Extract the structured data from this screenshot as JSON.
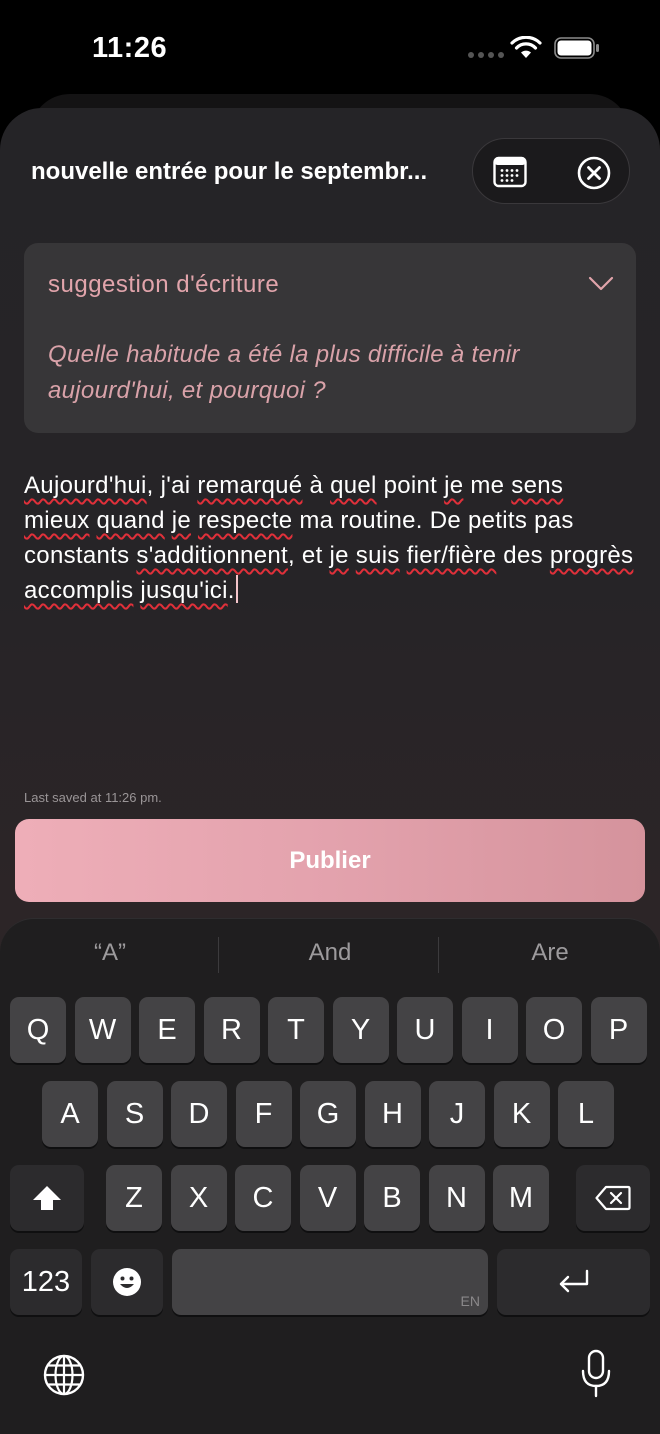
{
  "status_bar": {
    "time": "11:26"
  },
  "header": {
    "title": "nouvelle entrée pour le septembr..."
  },
  "suggestion": {
    "label": "suggestion d'écriture",
    "prompt": "Quelle habitude a été la plus difficile à tenir aujourd'hui, et pourquoi ?"
  },
  "entry": {
    "text": "Aujourd'hui, j'ai remarqué à quel point je me sens mieux quand je respecte ma routine. De petits pas constants s'additionnent, et je suis fier/fière des progrès accomplis jusqu'ici."
  },
  "last_saved": "Last saved at 11:26 pm.",
  "publish_label": "Publier",
  "keyboard": {
    "predictions": [
      "“A”",
      "And",
      "Are"
    ],
    "row1": [
      "Q",
      "W",
      "E",
      "R",
      "T",
      "Y",
      "U",
      "I",
      "O",
      "P"
    ],
    "row2": [
      "A",
      "S",
      "D",
      "F",
      "G",
      "H",
      "J",
      "K",
      "L"
    ],
    "row3": [
      "Z",
      "X",
      "C",
      "V",
      "B",
      "N",
      "M"
    ],
    "numbers_label": "123",
    "space_lang": "EN"
  },
  "colors": {
    "accent": "#e8a7b1",
    "suggestion_text": "#d9a2a9",
    "spell_underline": "#e0303a"
  }
}
